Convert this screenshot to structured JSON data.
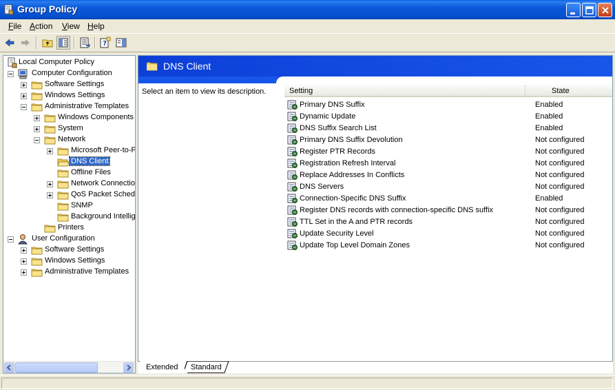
{
  "window": {
    "title": "Group Policy"
  },
  "menu": [
    {
      "label": "File",
      "u": "F",
      "rest": "ile"
    },
    {
      "label": "Action",
      "u": "A",
      "rest": "ction"
    },
    {
      "label": "View",
      "u": "V",
      "rest": "iew"
    },
    {
      "label": "Help",
      "u": "H",
      "rest": "elp"
    }
  ],
  "tree": [
    {
      "label": "Local Computer Policy"
    },
    {
      "label": "Computer Configuration"
    },
    {
      "label": "Software Settings"
    },
    {
      "label": "Windows Settings"
    },
    {
      "label": "Administrative Templates"
    },
    {
      "label": "Windows Components"
    },
    {
      "label": "System"
    },
    {
      "label": "Network"
    },
    {
      "label": "Microsoft Peer-to-P"
    },
    {
      "label": "DNS Client"
    },
    {
      "label": "Offline Files"
    },
    {
      "label": "Network Connectio"
    },
    {
      "label": "QoS Packet Schedu"
    },
    {
      "label": "SNMP"
    },
    {
      "label": "Background Intellig"
    },
    {
      "label": "Printers"
    },
    {
      "label": "User Configuration"
    },
    {
      "label": "Software Settings"
    },
    {
      "label": "Windows Settings"
    },
    {
      "label": "Administrative Templates"
    }
  ],
  "details": {
    "title": "DNS Client",
    "description": "Select an item to view its description.",
    "columns": {
      "setting": "Setting",
      "state": "State"
    },
    "rows": [
      {
        "setting": "Primary DNS Suffix",
        "state": "Enabled"
      },
      {
        "setting": "Dynamic Update",
        "state": "Enabled"
      },
      {
        "setting": "DNS Suffix Search List",
        "state": "Enabled"
      },
      {
        "setting": "Primary DNS Suffix Devolution",
        "state": "Not configured"
      },
      {
        "setting": "Register PTR Records",
        "state": "Not configured"
      },
      {
        "setting": "Registration Refresh Interval",
        "state": "Not configured"
      },
      {
        "setting": "Replace Addresses In Conflicts",
        "state": "Not configured"
      },
      {
        "setting": "DNS Servers",
        "state": "Not configured"
      },
      {
        "setting": "Connection-Specific DNS Suffix",
        "state": "Enabled"
      },
      {
        "setting": "Register DNS records with connection-specific DNS suffix",
        "state": "Not configured"
      },
      {
        "setting": "TTL Set in the A and PTR records",
        "state": "Not configured"
      },
      {
        "setting": "Update Security Level",
        "state": "Not configured"
      },
      {
        "setting": "Update Top Level Domain Zones",
        "state": "Not configured"
      }
    ]
  },
  "tabs": [
    {
      "label": "Extended"
    },
    {
      "label": "Standard"
    }
  ],
  "colors": {
    "titlebar": "#0A58D8",
    "header_band": "#1756E8",
    "selection": "#316AC5"
  }
}
